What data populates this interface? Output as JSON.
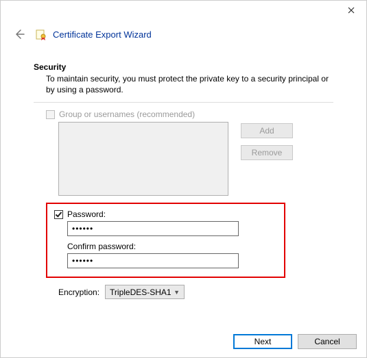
{
  "window": {
    "title": "Certificate Export Wizard"
  },
  "section": {
    "heading": "Security",
    "description": "To maintain security, you must protect the private key to a security principal or by using a password."
  },
  "group": {
    "checkbox_label": "Group or usernames (recommended)",
    "add_label": "Add",
    "remove_label": "Remove"
  },
  "password": {
    "checkbox_label": "Password:",
    "value": "••••••",
    "confirm_label": "Confirm password:",
    "confirm_value": "••••••"
  },
  "encryption": {
    "label": "Encryption:",
    "selected": "TripleDES-SHA1"
  },
  "footer": {
    "next": "Next",
    "cancel": "Cancel"
  }
}
